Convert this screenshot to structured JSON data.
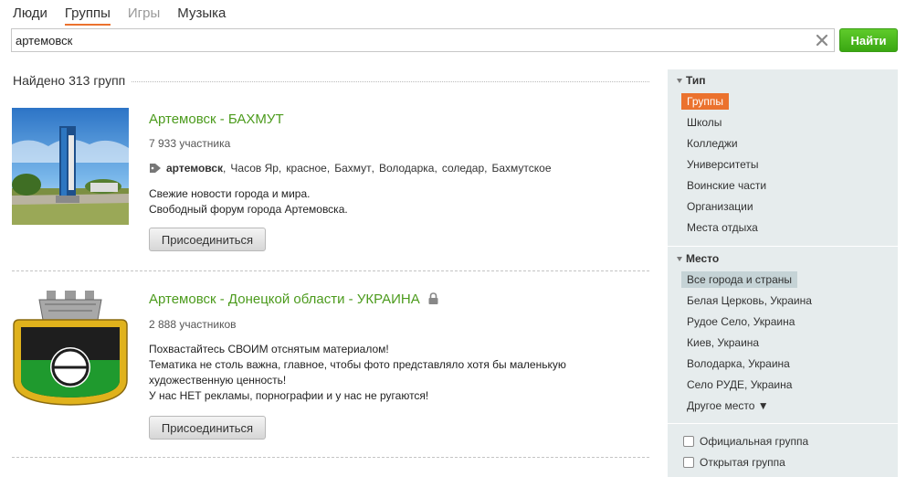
{
  "tabs": [
    {
      "label": "Люди"
    },
    {
      "label": "Группы"
    },
    {
      "label": "Игры"
    },
    {
      "label": "Музыка"
    }
  ],
  "search": {
    "value": "артемовск",
    "button_label": "Найти"
  },
  "found_text": "Найдено 313 групп",
  "results": [
    {
      "title": "Артемовск - БАХМУТ",
      "members": "7 933 участника",
      "tags": [
        "артемовск",
        "Часов Яр",
        "красное",
        "Бахмут",
        "Володарка",
        "соледар",
        "Бахмутское"
      ],
      "description": [
        "Свежие новости города и мира.",
        "Свободный форум города Артемовска."
      ],
      "join_label": "Присоединиться"
    },
    {
      "title": "Артемовск - Донецкой области - УКРАИНА",
      "members": "2 888 участников",
      "description": [
        "Похвастайтесь СВОИМ отснятым материалом!",
        "Тематика не столь важна, главное, чтобы фото представляло хотя бы маленькую",
        "художественную ценность!",
        "У нас НЕТ рекламы,  порнографии и у нас не ругаются!"
      ],
      "join_label": "Присоединиться"
    }
  ],
  "sidebar": {
    "type_header": "Тип",
    "type_items": [
      "Группы",
      "Школы",
      "Колледжи",
      "Университеты",
      "Воинские части",
      "Организации",
      "Места отдыха"
    ],
    "place_header": "Место",
    "place_items": [
      "Все города и страны",
      "Белая Церковь, Украина",
      "Рудое Село, Украина",
      "Киев, Украина",
      "Володарка, Украина",
      "Село РУДЕ, Украина",
      "Другое место ▼"
    ],
    "checkboxes": [
      "Официальная группа",
      "Открытая группа"
    ]
  },
  "colors": {
    "accent_orange": "#eb722e",
    "link_green": "#4c9b1d",
    "button_green": "#3aa712",
    "sidebar_bg": "#e6eced"
  }
}
